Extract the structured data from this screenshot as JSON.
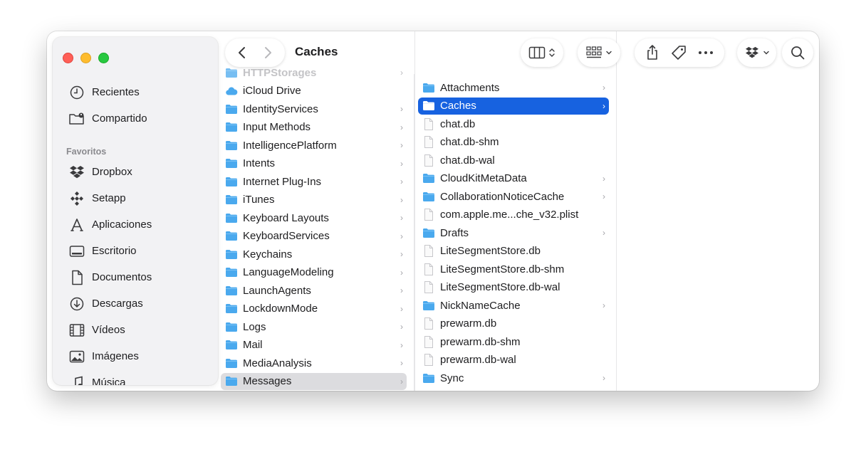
{
  "window": {
    "title": "Caches"
  },
  "traffic_lights": {
    "close": "#ff5f57",
    "minimize": "#febc2e",
    "zoom": "#28c840"
  },
  "sidebar": {
    "top_items": [
      {
        "label": "Recientes",
        "icon": "clock-icon"
      },
      {
        "label": "Compartido",
        "icon": "shared-folder-icon"
      }
    ],
    "favorites_heading": "Favoritos",
    "favorites": [
      {
        "label": "Dropbox",
        "icon": "dropbox-icon"
      },
      {
        "label": "Setapp",
        "icon": "setapp-icon"
      },
      {
        "label": "Aplicaciones",
        "icon": "applications-icon"
      },
      {
        "label": "Escritorio",
        "icon": "desktop-icon"
      },
      {
        "label": "Documentos",
        "icon": "document-icon"
      },
      {
        "label": "Descargas",
        "icon": "download-icon"
      },
      {
        "label": "Vídeos",
        "icon": "film-icon"
      },
      {
        "label": "Imágenes",
        "icon": "photo-icon"
      },
      {
        "label": "Música",
        "icon": "music-icon"
      }
    ]
  },
  "toolbar": {
    "back": "chevron-left-icon",
    "forward": "chevron-right-icon",
    "view": "columns-view-icon",
    "group": "group-grid-icon",
    "share": "share-icon",
    "tag": "tag-icon",
    "more": "more-icon",
    "dropbox": "dropbox-icon",
    "search": "search-icon"
  },
  "column1": {
    "items": [
      {
        "name": "HTTPStorages",
        "type": "folder",
        "chevron": true,
        "faded": true
      },
      {
        "name": "iCloud Drive",
        "type": "icloud",
        "chevron": false
      },
      {
        "name": "IdentityServices",
        "type": "folder",
        "chevron": true
      },
      {
        "name": "Input Methods",
        "type": "folder",
        "chevron": true
      },
      {
        "name": "IntelligencePlatform",
        "type": "folder",
        "chevron": true
      },
      {
        "name": "Intents",
        "type": "folder",
        "chevron": true
      },
      {
        "name": "Internet Plug-Ins",
        "type": "folder",
        "chevron": true
      },
      {
        "name": "iTunes",
        "type": "folder",
        "chevron": true
      },
      {
        "name": "Keyboard Layouts",
        "type": "folder",
        "chevron": true
      },
      {
        "name": "KeyboardServices",
        "type": "folder",
        "chevron": true
      },
      {
        "name": "Keychains",
        "type": "folder",
        "chevron": true
      },
      {
        "name": "LanguageModeling",
        "type": "folder",
        "chevron": true
      },
      {
        "name": "LaunchAgents",
        "type": "folder",
        "chevron": true
      },
      {
        "name": "LockdownMode",
        "type": "folder",
        "chevron": true
      },
      {
        "name": "Logs",
        "type": "folder",
        "chevron": true
      },
      {
        "name": "Mail",
        "type": "folder",
        "chevron": true
      },
      {
        "name": "MediaAnalysis",
        "type": "folder",
        "chevron": true
      },
      {
        "name": "Messages",
        "type": "folder",
        "chevron": true,
        "selected": "gray"
      }
    ]
  },
  "column2": {
    "items": [
      {
        "name": "Attachments",
        "type": "folder",
        "chevron": true
      },
      {
        "name": "Caches",
        "type": "folder",
        "chevron": true,
        "selected": "blue"
      },
      {
        "name": "chat.db",
        "type": "file",
        "chevron": false
      },
      {
        "name": "chat.db-shm",
        "type": "file",
        "chevron": false
      },
      {
        "name": "chat.db-wal",
        "type": "file",
        "chevron": false
      },
      {
        "name": "CloudKitMetaData",
        "type": "folder",
        "chevron": true
      },
      {
        "name": "CollaborationNoticeCache",
        "type": "folder",
        "chevron": true
      },
      {
        "name": "com.apple.me...che_v32.plist",
        "type": "file",
        "chevron": false
      },
      {
        "name": "Drafts",
        "type": "folder",
        "chevron": true
      },
      {
        "name": "LiteSegmentStore.db",
        "type": "file",
        "chevron": false
      },
      {
        "name": "LiteSegmentStore.db-shm",
        "type": "file",
        "chevron": false
      },
      {
        "name": "LiteSegmentStore.db-wal",
        "type": "file",
        "chevron": false
      },
      {
        "name": "NickNameCache",
        "type": "folder",
        "chevron": true
      },
      {
        "name": "prewarm.db",
        "type": "file",
        "chevron": false
      },
      {
        "name": "prewarm.db-shm",
        "type": "file",
        "chevron": false
      },
      {
        "name": "prewarm.db-wal",
        "type": "file",
        "chevron": false
      },
      {
        "name": "Sync",
        "type": "folder",
        "chevron": true
      }
    ]
  },
  "colors": {
    "selection_blue": "#1762e0",
    "selection_gray": "#dcdcdf",
    "folder_blue": "#4aa9ee"
  }
}
